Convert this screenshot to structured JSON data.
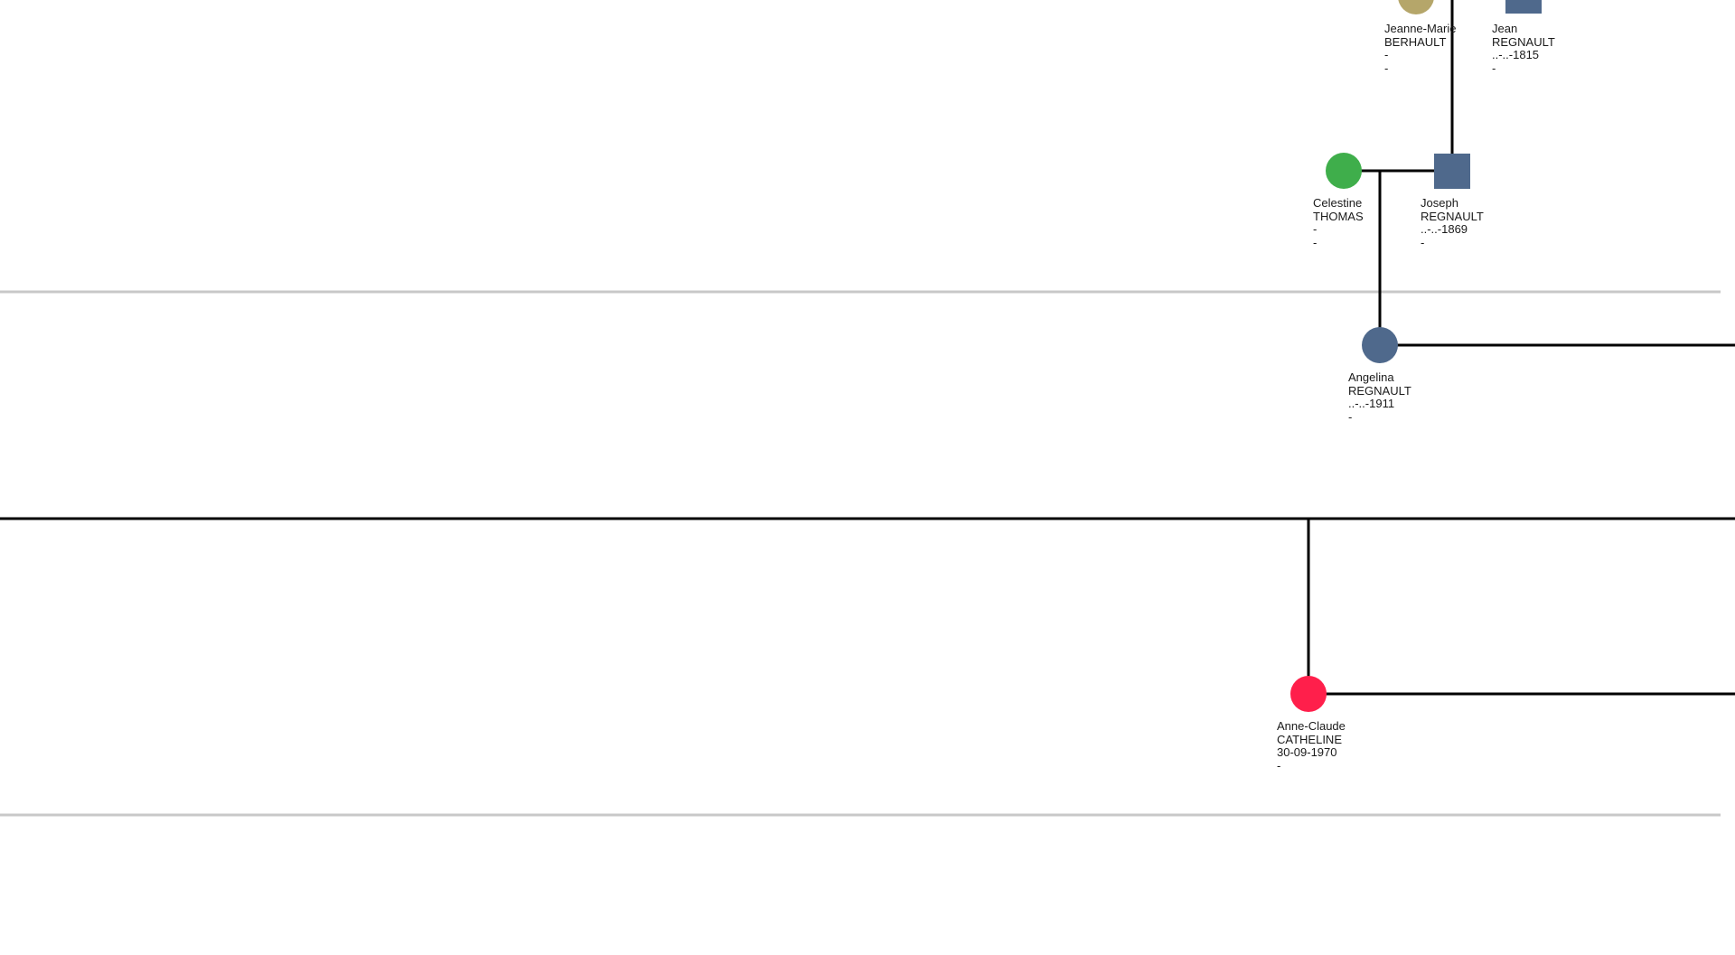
{
  "colors": {
    "line": "#000000",
    "separator": "#c8c8c8",
    "male": "#4f698c",
    "female_blue": "#4f698c",
    "gold": "#b5a66a",
    "green": "#3fae4b",
    "red": "#ff1f4b",
    "text": "#1a1a1a"
  },
  "people": {
    "jeanne_marie": {
      "first": "Jeanne-Marie",
      "last": "BERHAULT",
      "dates": "-",
      "extra": "-",
      "shape": "circle",
      "color": "gold"
    },
    "jean": {
      "first": "Jean",
      "last": "REGNAULT",
      "dates": "..-..-1815",
      "extra": "-",
      "shape": "square",
      "color": "male"
    },
    "celestine": {
      "first": "Celestine",
      "last": "THOMAS",
      "dates": "-",
      "extra": "-",
      "shape": "circle",
      "color": "green"
    },
    "joseph": {
      "first": "Joseph",
      "last": "REGNAULT",
      "dates": "..-..-1869",
      "extra": "-",
      "shape": "square",
      "color": "male"
    },
    "angelina": {
      "first": "Angelina",
      "last": "REGNAULT",
      "dates": "..-..-1911",
      "extra": "-",
      "shape": "circle",
      "color": "female_blue"
    },
    "anne_claude": {
      "first": "Anne-Claude",
      "last": "CATHELINE",
      "dates": "30-09-1970",
      "extra": "-",
      "shape": "circle",
      "color": "red"
    }
  }
}
